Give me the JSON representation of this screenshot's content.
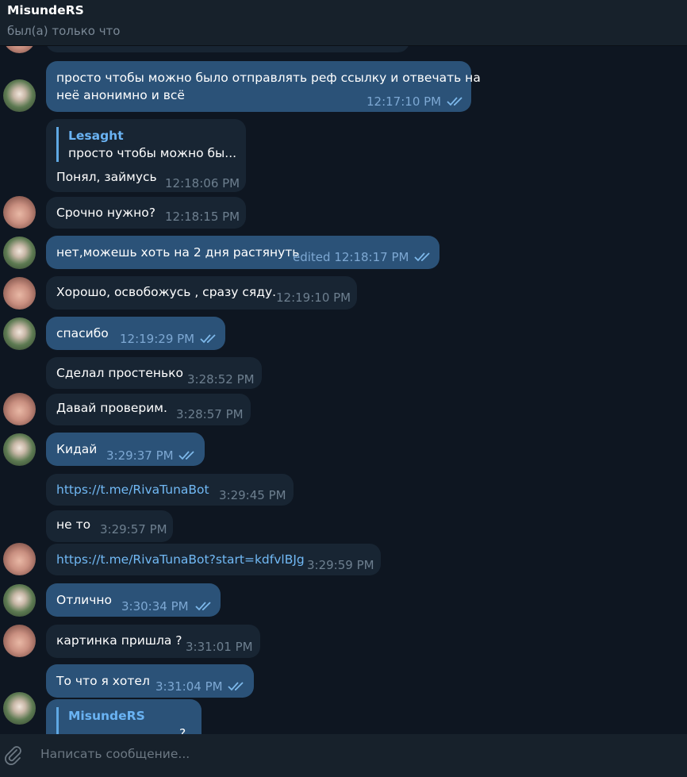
{
  "header": {
    "title": "MisundeRS",
    "status": "был(а) только что"
  },
  "messages": [
    {
      "text1": "просто чтобы можно было отправлять реф ссылку и отвечать на",
      "text2": "неё анонимно и всё",
      "time": "12:17:10 PM"
    },
    {
      "reply_name": "Lesaght",
      "reply_text": "просто чтобы можно бы...",
      "text": "Понял, займусь",
      "time": "12:18:06 PM"
    },
    {
      "text": "Срочно нужно?",
      "time": "12:18:15 PM"
    },
    {
      "text": "нет,можешь хоть на 2 дня растянуть",
      "time": "edited 12:18:17 PM"
    },
    {
      "text": "Хорошо, освобожусь , сразу сяду.",
      "time": "12:19:10 PM"
    },
    {
      "text": "спасибо",
      "time": "12:19:29 PM"
    },
    {
      "text": "Сделал простенько",
      "time": "3:28:52 PM"
    },
    {
      "text": "Давай проверим.",
      "time": "3:28:57 PM"
    },
    {
      "text": "Кидай",
      "time": "3:29:37 PM"
    },
    {
      "text": "https://t.me/RivaTunaBot",
      "time": "3:29:45 PM"
    },
    {
      "text": "не то",
      "time": "3:29:57 PM"
    },
    {
      "text": "https://t.me/RivaTunaBot?start=kdfvlBJg",
      "time": "3:29:59 PM"
    },
    {
      "text": "Отлично",
      "time": "3:30:34 PM"
    },
    {
      "text": "картинка пришла ?",
      "time": "3:31:01 PM"
    },
    {
      "text": "То что я хотел",
      "time": "3:31:04 PM"
    },
    {
      "reply_name": "MisundeRS",
      "reply_text": "?"
    }
  ],
  "composer": {
    "placeholder": "Написать сообщение...",
    "attach_icon": "paperclip-icon"
  },
  "colors": {
    "background": "#0e1621",
    "incoming_bubble": "#182533",
    "outgoing_bubble": "#2b5278",
    "link": "#71b9f5",
    "reply_accent": "#6ab3f3"
  }
}
